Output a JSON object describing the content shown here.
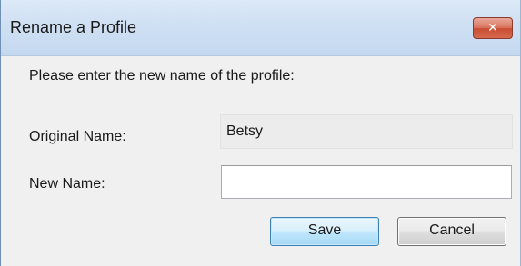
{
  "window": {
    "title": "Rename a Profile",
    "close_glyph": "✕",
    "close_icon": "close-icon"
  },
  "form": {
    "prompt": "Please enter the new name of the profile:",
    "original_label": "Original Name:",
    "original_value": "Betsy",
    "new_label": "New Name:",
    "new_value": "",
    "new_placeholder": ""
  },
  "buttons": {
    "save_label": "Save",
    "cancel_label": "Cancel"
  },
  "colors": {
    "titlebar": "#cfe0f3",
    "close_button": "#c84d33",
    "dialog_background": "#f0f0f0",
    "save_border": "#3c7fb1"
  }
}
